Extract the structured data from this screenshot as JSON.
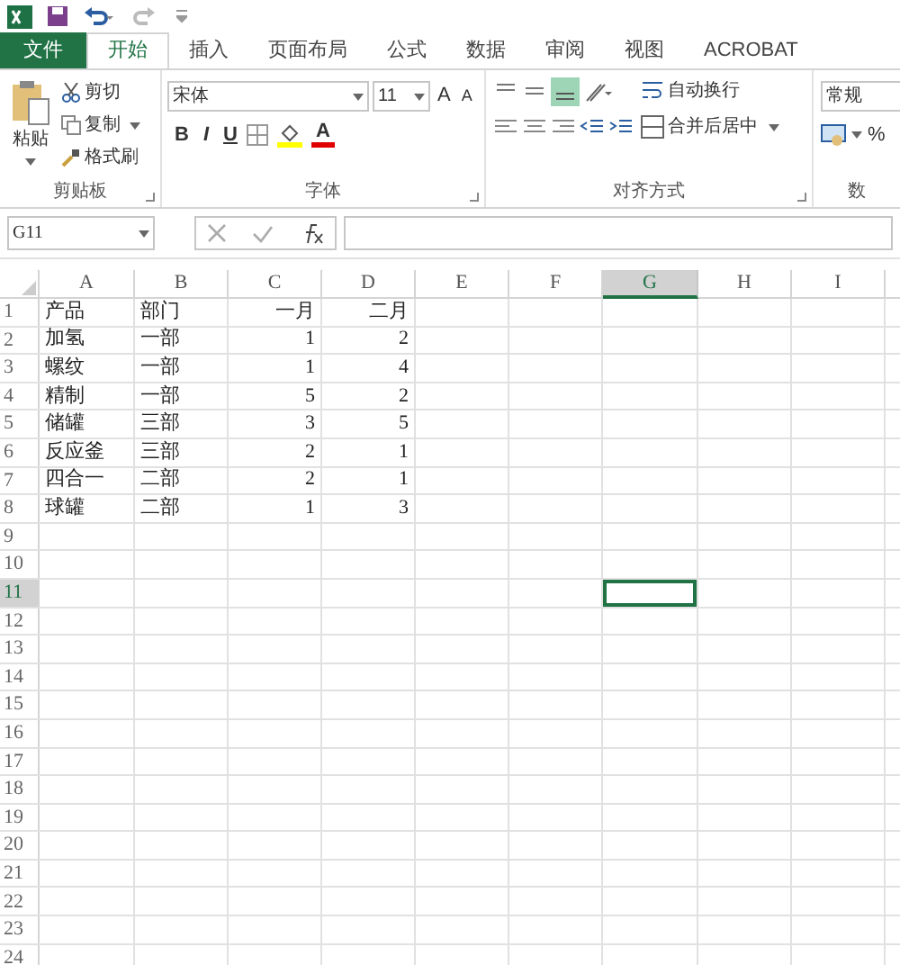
{
  "tabs": [
    {
      "label": "文件",
      "kind": "file",
      "selected": false
    },
    {
      "label": "开始",
      "kind": "tab",
      "selected": true
    },
    {
      "label": "插入",
      "kind": "tab",
      "selected": false
    },
    {
      "label": "页面布局",
      "kind": "tab",
      "selected": false
    },
    {
      "label": "公式",
      "kind": "tab",
      "selected": false
    },
    {
      "label": "数据",
      "kind": "tab",
      "selected": false
    },
    {
      "label": "审阅",
      "kind": "tab",
      "selected": false
    },
    {
      "label": "视图",
      "kind": "tab",
      "selected": false
    },
    {
      "label": "ACROBAT",
      "kind": "tab",
      "selected": false
    }
  ],
  "clipboard": {
    "paste": "粘贴",
    "cut": "剪切",
    "copy": "复制",
    "format_painter": "格式刷",
    "label": "剪贴板"
  },
  "font": {
    "name": "宋体",
    "size": "11",
    "grow": "A",
    "shrink": "A",
    "bold": "B",
    "italic": "I",
    "underline": "U",
    "font_color": "A",
    "label": "字体"
  },
  "alignment": {
    "wrap": "自动换行",
    "merge": "合并后居中",
    "label": "对齐方式",
    "bottom_align_selected": true
  },
  "number": {
    "format": "常规",
    "percent": "%",
    "label": "数"
  },
  "name_box": "G11",
  "columns": [
    {
      "label": "A",
      "selected": false,
      "kind": "text"
    },
    {
      "label": "B",
      "selected": false,
      "kind": "text"
    },
    {
      "label": "C",
      "selected": false,
      "kind": "number"
    },
    {
      "label": "D",
      "selected": false,
      "kind": "number"
    },
    {
      "label": "E",
      "selected": false
    },
    {
      "label": "F",
      "selected": false
    },
    {
      "label": "G",
      "selected": true
    },
    {
      "label": "H",
      "selected": false
    },
    {
      "label": "I",
      "selected": false
    }
  ],
  "rows": [
    {
      "label": "1",
      "selected": false,
      "cells": [
        "产品",
        "部门",
        "一月",
        "二月"
      ]
    },
    {
      "label": "2",
      "selected": false,
      "cells": [
        "加氢",
        "一部",
        "1",
        "2"
      ]
    },
    {
      "label": "3",
      "selected": false,
      "cells": [
        "螺纹",
        "一部",
        "1",
        "4"
      ]
    },
    {
      "label": "4",
      "selected": false,
      "cells": [
        "精制",
        "一部",
        "5",
        "2"
      ]
    },
    {
      "label": "5",
      "selected": false,
      "cells": [
        "储罐",
        "三部",
        "3",
        "5"
      ]
    },
    {
      "label": "6",
      "selected": false,
      "cells": [
        "反应釜",
        "三部",
        "2",
        "1"
      ]
    },
    {
      "label": "7",
      "selected": false,
      "cells": [
        "四合一",
        "二部",
        "2",
        "1"
      ]
    },
    {
      "label": "8",
      "selected": false,
      "cells": [
        "球罐",
        "二部",
        "1",
        "3"
      ]
    },
    {
      "label": "9",
      "selected": false
    },
    {
      "label": "10",
      "selected": false
    },
    {
      "label": "11",
      "selected": true
    },
    {
      "label": "12",
      "selected": false
    },
    {
      "label": "13",
      "selected": false
    },
    {
      "label": "14",
      "selected": false
    },
    {
      "label": "15",
      "selected": false
    },
    {
      "label": "16",
      "selected": false
    },
    {
      "label": "17",
      "selected": false
    },
    {
      "label": "18",
      "selected": false
    },
    {
      "label": "19",
      "selected": false
    },
    {
      "label": "20",
      "selected": false
    },
    {
      "label": "21",
      "selected": false
    },
    {
      "label": "22",
      "selected": false
    },
    {
      "label": "23",
      "selected": false
    },
    {
      "label": "24",
      "selected": false
    }
  ]
}
